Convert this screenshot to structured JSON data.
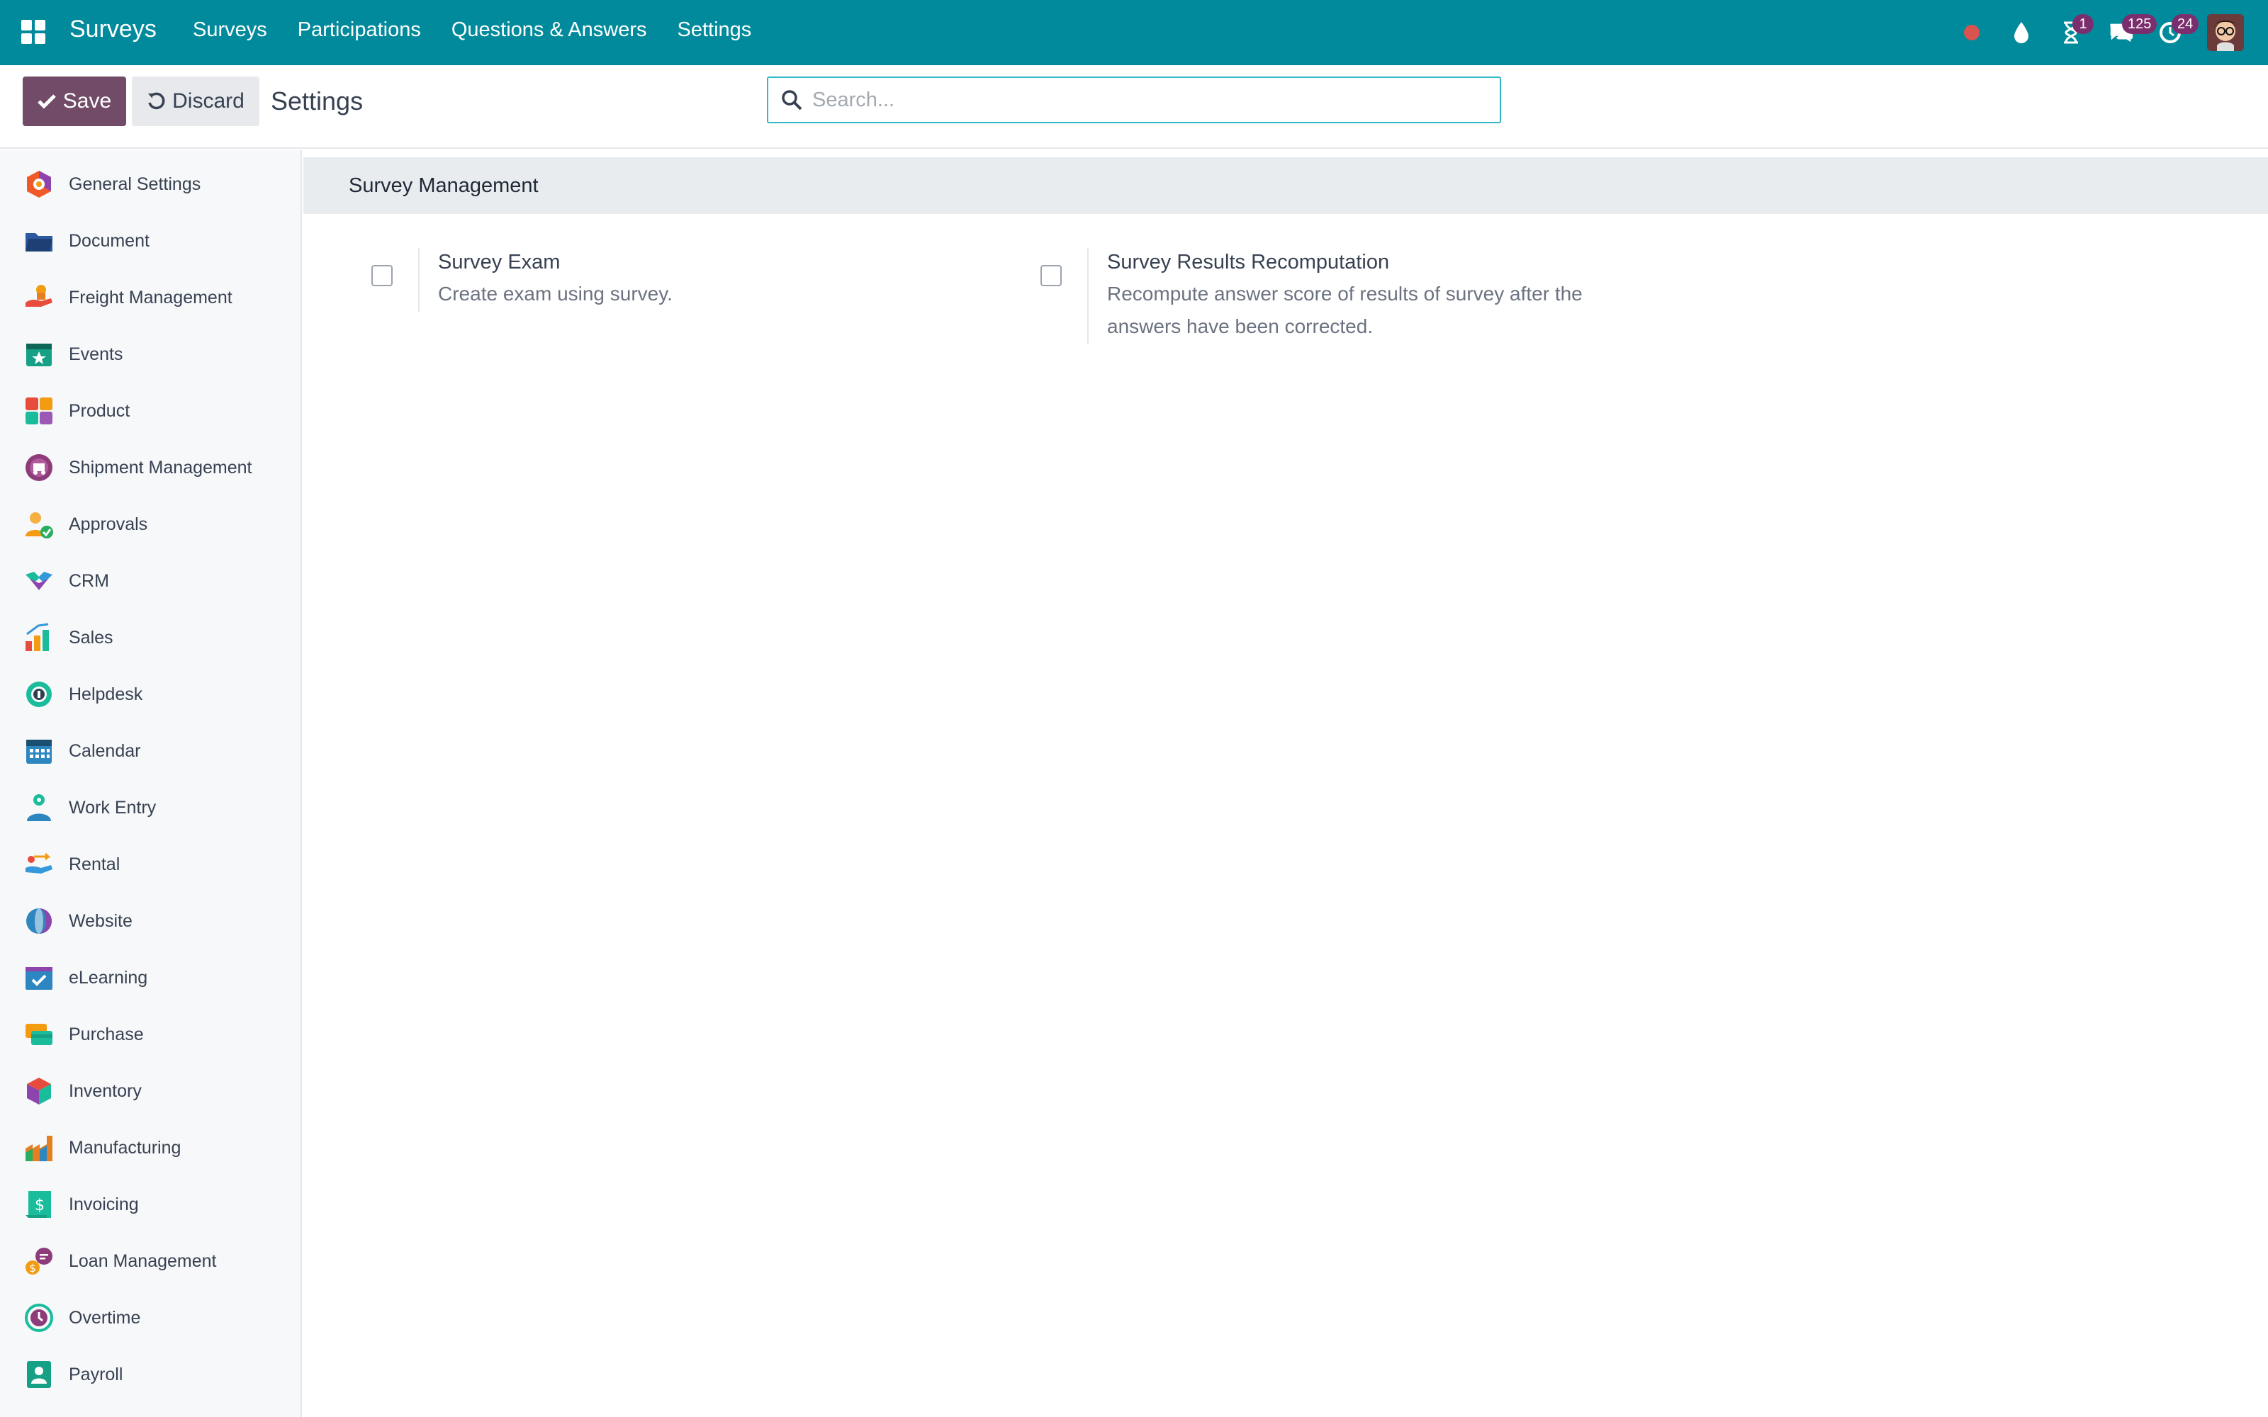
{
  "navbar": {
    "brand": "Surveys",
    "menu": [
      "Surveys",
      "Participations",
      "Questions & Answers",
      "Settings"
    ],
    "badges": {
      "activities": "1",
      "messages": "125",
      "updates": "24"
    }
  },
  "control": {
    "save_label": "Save",
    "discard_label": "Discard",
    "title": "Settings",
    "search_placeholder": "Search..."
  },
  "sidebar": {
    "items": [
      {
        "label": "General Settings",
        "icon": "general-settings-icon"
      },
      {
        "label": "Document",
        "icon": "document-icon"
      },
      {
        "label": "Freight Management",
        "icon": "freight-icon"
      },
      {
        "label": "Events",
        "icon": "events-icon"
      },
      {
        "label": "Product",
        "icon": "product-icon"
      },
      {
        "label": "Shipment Management",
        "icon": "shipment-icon"
      },
      {
        "label": "Approvals",
        "icon": "approvals-icon"
      },
      {
        "label": "CRM",
        "icon": "crm-icon"
      },
      {
        "label": "Sales",
        "icon": "sales-icon"
      },
      {
        "label": "Helpdesk",
        "icon": "helpdesk-icon"
      },
      {
        "label": "Calendar",
        "icon": "calendar-icon"
      },
      {
        "label": "Work Entry",
        "icon": "work-entry-icon"
      },
      {
        "label": "Rental",
        "icon": "rental-icon"
      },
      {
        "label": "Website",
        "icon": "website-icon"
      },
      {
        "label": "eLearning",
        "icon": "elearning-icon"
      },
      {
        "label": "Purchase",
        "icon": "purchase-icon"
      },
      {
        "label": "Inventory",
        "icon": "inventory-icon"
      },
      {
        "label": "Manufacturing",
        "icon": "manufacturing-icon"
      },
      {
        "label": "Invoicing",
        "icon": "invoicing-icon"
      },
      {
        "label": "Loan Management",
        "icon": "loan-icon"
      },
      {
        "label": "Overtime",
        "icon": "overtime-icon"
      },
      {
        "label": "Payroll",
        "icon": "payroll-icon"
      }
    ]
  },
  "main": {
    "section_title": "Survey Management",
    "settings": [
      {
        "title": "Survey Exam",
        "description": "Create exam using survey.",
        "checked": false
      },
      {
        "title": "Survey Results Recomputation",
        "description": "Recompute answer score of results of survey after the answers have been corrected.",
        "checked": false
      }
    ]
  },
  "colors": {
    "navbar": "#018a9b",
    "primary": "#714b67",
    "section_bg": "#e9ecef"
  }
}
